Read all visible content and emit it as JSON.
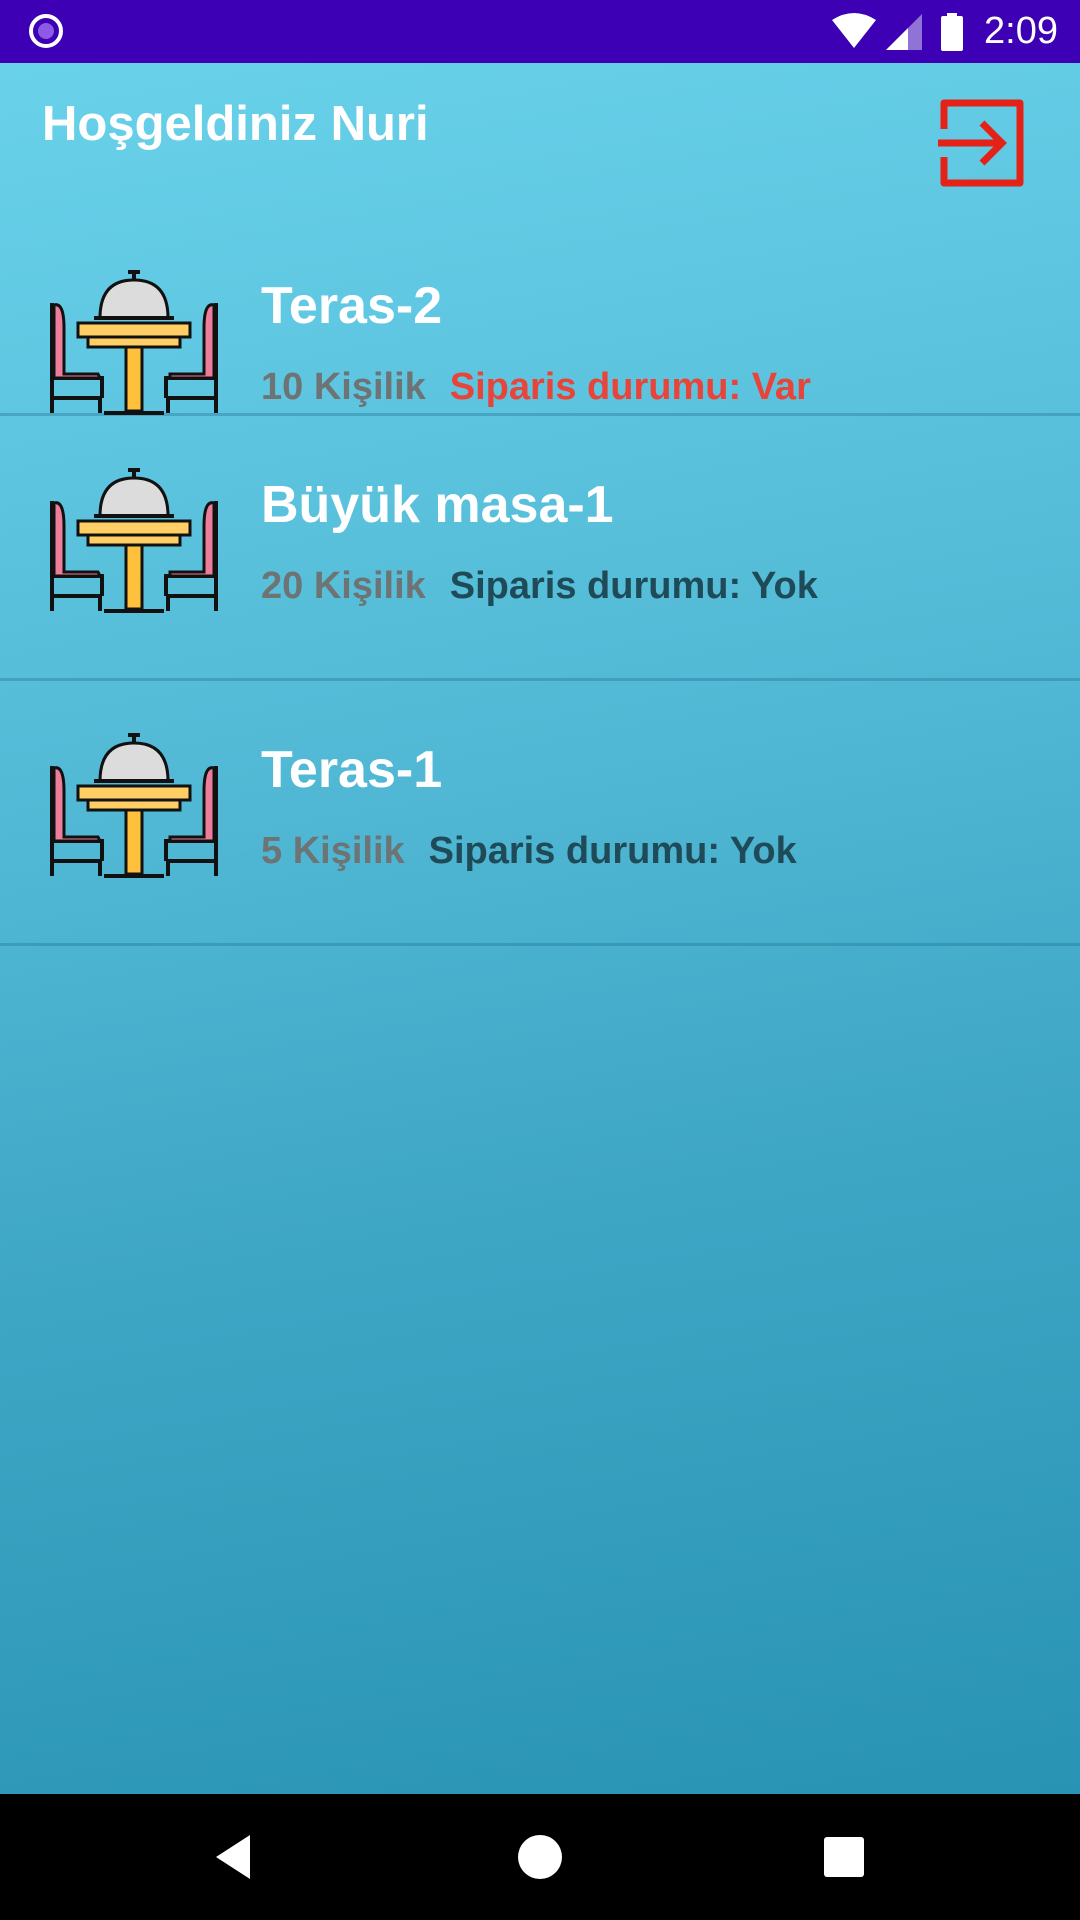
{
  "status_bar": {
    "time": "2:09",
    "icons": [
      "app-notification-icon",
      "wifi-icon",
      "cellular-signal-icon",
      "battery-icon"
    ]
  },
  "header": {
    "welcome": "Hoşgeldiniz Nuri",
    "logout_icon": "logout-icon",
    "accent_color": "#e52217"
  },
  "tables": [
    {
      "name": "Teras-2",
      "capacity": "10 Kişilik",
      "order_status": "Siparis durumu: Var",
      "has_order": true
    },
    {
      "name": "Büyük masa-1",
      "capacity": "20 Kişilik",
      "order_status": "Siparis durumu: Yok",
      "has_order": false
    },
    {
      "name": "Teras-1",
      "capacity": "5 Kişilik",
      "order_status": "Siparis durumu: Yok",
      "has_order": false
    }
  ],
  "colors": {
    "status_bar": "#3d00b4",
    "order_yes": "#e8443a",
    "order_no": "#1f4a57",
    "capacity": "#6e7373"
  },
  "nav_bar": {
    "icons": [
      "back-icon",
      "home-icon",
      "recents-icon"
    ]
  }
}
